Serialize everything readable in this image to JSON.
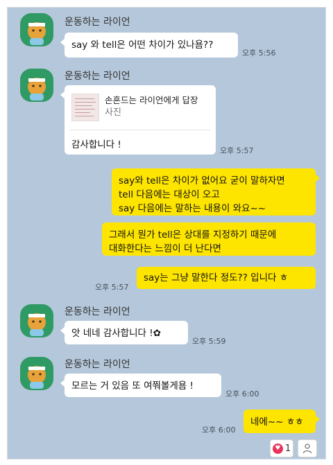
{
  "sender": "운동하는 라이언",
  "messages": [
    {
      "text": "say 와 tell은 어떤 차이가 있나욤??",
      "time": "오후 5:56"
    },
    {
      "reply_title": "손흔드는 라이언에게 답장",
      "reply_sub": "사진",
      "text": "감사합니다 !",
      "time": "오후 5:57"
    },
    {
      "lines": [
        "say와 tell은 차이가 없어요 굳이 말하자면",
        "tell 다음에는 대상이 오고",
        "say 다음에는 말하는 내용이 와요~~"
      ]
    },
    {
      "lines": [
        "그래서 뭔가 tell은 상대를 지정하기 때문에",
        "대화한다는 느낌이 더 난다면"
      ]
    },
    {
      "text": "say는 그냥 말한다 정도?? 입니다 ㅎ",
      "time": "오후 5:57"
    },
    {
      "text": "앗 네네 감사합니다 !✿",
      "time": "오후 5:59"
    },
    {
      "text": "모르는 거 있음 또 여쭤볼게욤 !",
      "time": "오후 6:00"
    },
    {
      "text": "네에~~ ㅎㅎ",
      "time": "오후 6:00"
    }
  ],
  "reactions": {
    "like_count": "1",
    "icons": [
      "heart-icon",
      "person-icon"
    ]
  },
  "colors": {
    "background": "#b5c7da",
    "my_bubble": "#fee500",
    "their_bubble": "#ffffff",
    "avatar": "#2f9a63"
  }
}
